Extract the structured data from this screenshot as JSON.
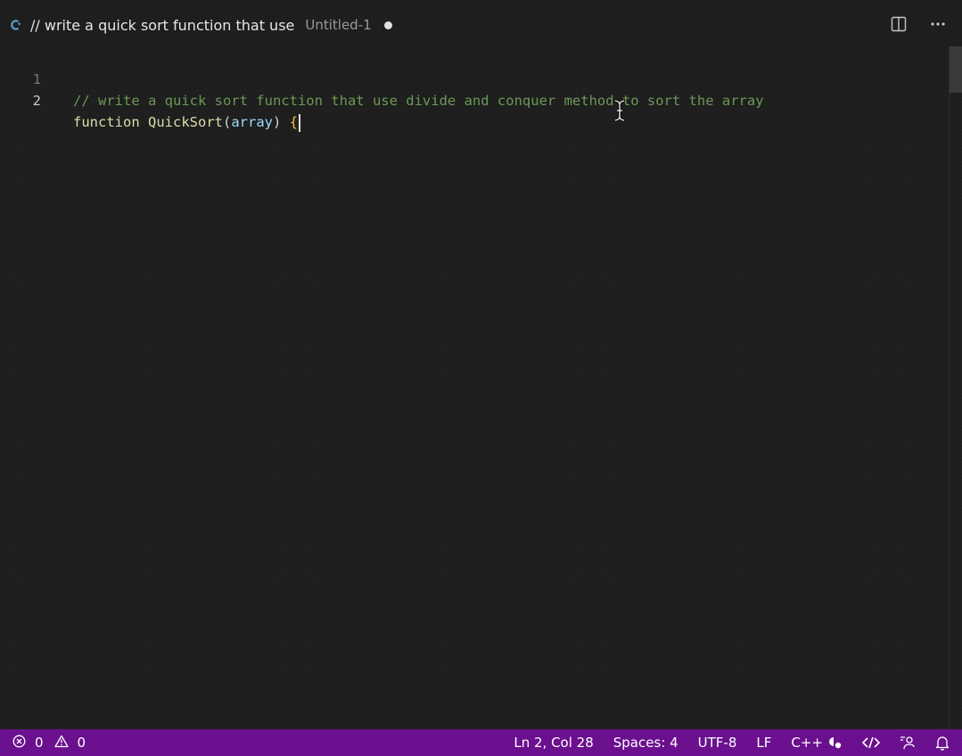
{
  "tab": {
    "title": "// write a quick sort function that use",
    "description": "Untitled-1",
    "icon": "cpp-language-icon",
    "dirty": true
  },
  "actions": {
    "split_editor_icon": "split-editor-icon",
    "more_icon": "more-actions-icon"
  },
  "editor": {
    "lines": [
      {
        "number": "1",
        "text": "// write a quick sort function that use divide and conquer method to sort the array"
      },
      {
        "number": "2",
        "keyword": "function",
        "name": "QuickSort",
        "open_paren": "(",
        "param": "array",
        "close_paren": ")",
        "brace": "{"
      }
    ],
    "active_line": 2
  },
  "status": {
    "errors": "0",
    "warnings": "0",
    "position": "Ln 2, Col 28",
    "indent": "Spaces: 4",
    "encoding": "UTF-8",
    "eol": "LF",
    "language": "C++",
    "colors": {
      "bar": "#6a0f8e"
    }
  }
}
